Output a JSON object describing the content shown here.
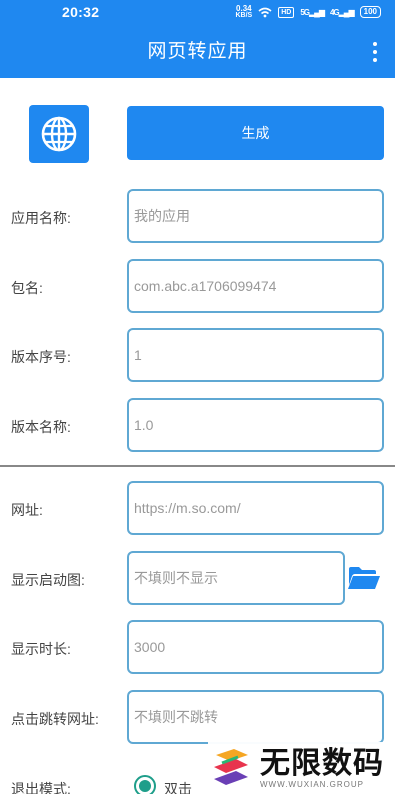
{
  "status_bar": {
    "time": "20:32",
    "net_speed_value": "0.34",
    "net_speed_unit": "KB/S",
    "hd_label": "HD",
    "signal1": "5G",
    "signal2": "4G",
    "battery": "100"
  },
  "app_bar": {
    "title": "网页转应用",
    "menu_icon": "more-vert-icon"
  },
  "colors": {
    "primary": "#1f88f0",
    "field_border": "#5fa8d3",
    "radio": "#1e9e8a"
  },
  "top_actions": {
    "icon": "globe-icon",
    "generate_label": "生成"
  },
  "form_top": [
    {
      "label": "应用名称:",
      "placeholder": "我的应用"
    },
    {
      "label": "包名:",
      "placeholder": "com.abc.a1706099474"
    },
    {
      "label": "版本序号:",
      "placeholder": "1"
    },
    {
      "label": "版本名称:",
      "placeholder": "1.0"
    }
  ],
  "form_bottom": [
    {
      "label": "网址:",
      "placeholder": "https://m.so.com/"
    },
    {
      "label": "显示启动图:",
      "placeholder": "不填则不显示",
      "icon": "folder-open-icon"
    },
    {
      "label": "显示时长:",
      "placeholder": "3000"
    },
    {
      "label": "点击跳转网址:",
      "placeholder": "不填则不跳转"
    }
  ],
  "exit_mode": {
    "label": "退出模式:",
    "selected_option": "双击"
  },
  "watermark": {
    "text_cn": "无限数码",
    "text_en": "WWW.WUXIAN.GROUP"
  }
}
